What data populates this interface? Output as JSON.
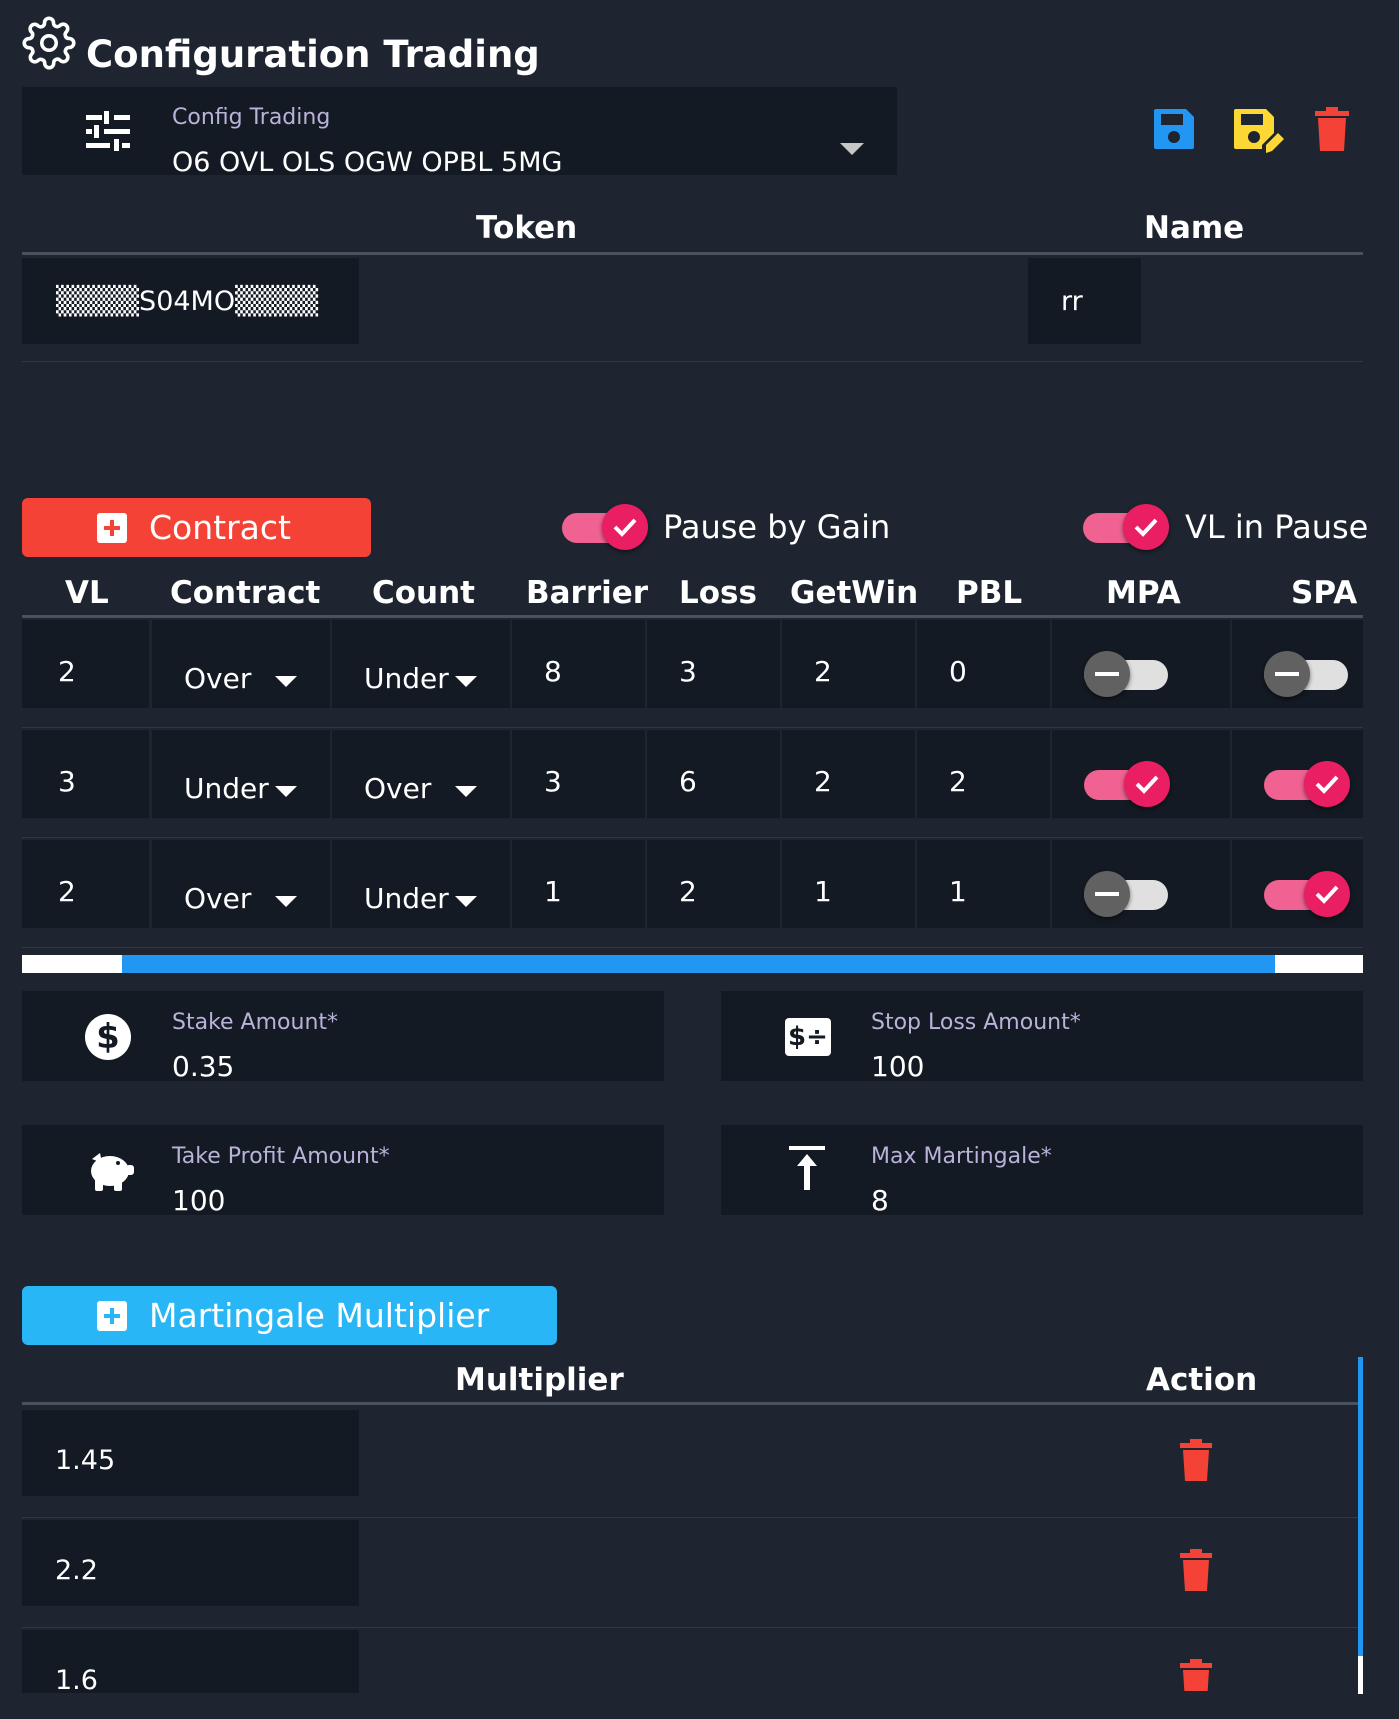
{
  "header": {
    "title": "Configuration Trading"
  },
  "config_select": {
    "label": "Config Trading",
    "value": "O6 OVL OLS OGW OPBL 5MG"
  },
  "colors": {
    "save": "#2196f3",
    "save_as": "#fdd835",
    "delete": "#f44336",
    "accent_red": "#f44336",
    "accent_blue": "#29b6f6",
    "toggle_on": "#e91e63",
    "progress": "#2196f3"
  },
  "token_table": {
    "headers": {
      "token": "Token",
      "name": "Name"
    },
    "row": {
      "token": "▒▒▒▒S04MO▒▒▒▒",
      "name": "rr"
    }
  },
  "contract_button": {
    "label": "Contract"
  },
  "pause_by_gain": {
    "label": "Pause by Gain",
    "on": true
  },
  "vl_in_pause": {
    "label": "VL in Pause",
    "on": true
  },
  "contracts": {
    "headers": [
      "VL",
      "Contract",
      "Count",
      "Barrier",
      "Loss",
      "GetWin",
      "PBL",
      "MPA",
      "SPA"
    ],
    "rows": [
      {
        "vl": "2",
        "contract": "Over",
        "count": "Under",
        "barrier": "8",
        "loss": "3",
        "getwin": "2",
        "pbl": "0",
        "mpa": false,
        "spa": false
      },
      {
        "vl": "3",
        "contract": "Under",
        "count": "Over",
        "barrier": "3",
        "loss": "6",
        "getwin": "2",
        "pbl": "2",
        "mpa": true,
        "spa": true
      },
      {
        "vl": "2",
        "contract": "Over",
        "count": "Under",
        "barrier": "1",
        "loss": "2",
        "getwin": "1",
        "pbl": "1",
        "mpa": false,
        "spa": true
      }
    ]
  },
  "scroll_progress": 0.86,
  "fields": {
    "stake": {
      "label": "Stake Amount*",
      "value": "0.35"
    },
    "stop_loss": {
      "label": "Stop Loss Amount*",
      "value": "100"
    },
    "take_profit": {
      "label": "Take Profit Amount*",
      "value": "100"
    },
    "max_martingale": {
      "label": "Max Martingale*",
      "value": "8"
    }
  },
  "martingale_button": {
    "label": "Martingale Multiplier"
  },
  "multiplier_table": {
    "headers": {
      "multiplier": "Multiplier",
      "action": "Action"
    },
    "rows": [
      {
        "value": "1.45"
      },
      {
        "value": "2.2"
      },
      {
        "value": "1.6"
      }
    ]
  }
}
